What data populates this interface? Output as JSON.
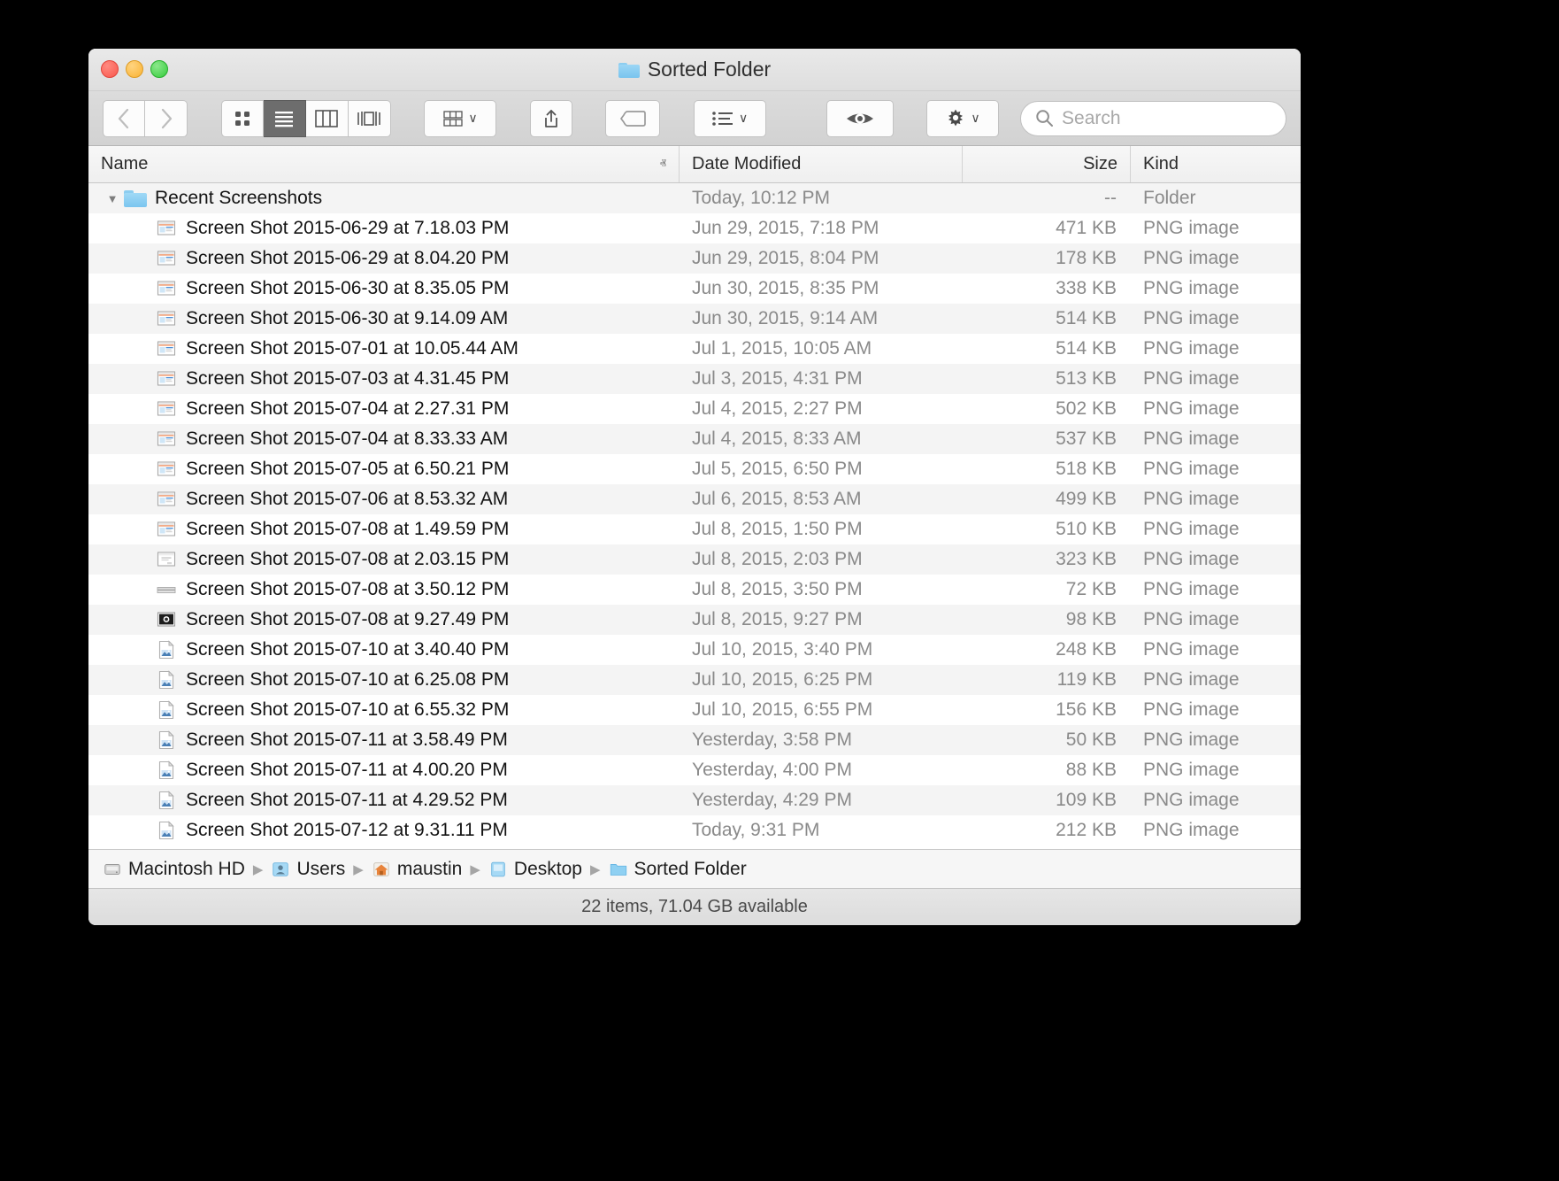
{
  "window": {
    "title": "Sorted Folder",
    "title_icon": "folder-icon",
    "traffic_lights": {
      "close_label": "close",
      "minimize_label": "minimize",
      "zoom_label": "zoom"
    }
  },
  "toolbar": {
    "back_label": "‹",
    "forward_label": "›",
    "view_icon_label": "icon-view",
    "view_list_label": "list-view",
    "view_column_label": "column-view",
    "view_coverflow_label": "coverflow-view",
    "arrange_label": "arrange",
    "share_label": "share",
    "tag_label": "tag",
    "action_list_label": "action-list",
    "quicklook_label": "quick-look",
    "settings_label": "settings",
    "chevron": "∨"
  },
  "search": {
    "placeholder": "Search",
    "value": "",
    "icon": "search-icon"
  },
  "columns": {
    "name": "Name",
    "date_modified": "Date Modified",
    "size": "Size",
    "kind": "Kind",
    "sort_arrow": "ⱏ",
    "sorted_by": "Name",
    "sort_direction": "ascending"
  },
  "rows": [
    {
      "name": "Recent Screenshots",
      "date": "Today, 10:12 PM",
      "size": "--",
      "kind": "Folder",
      "icon": "folder-icon",
      "type": "folder",
      "expanded": true,
      "depth": 0
    },
    {
      "name": "Screen Shot 2015-06-29 at 7.18.03 PM",
      "date": "Jun 29, 2015, 7:18 PM",
      "size": "471 KB",
      "kind": "PNG image",
      "icon": "screenshot-thumb-icon",
      "type": "file",
      "depth": 1
    },
    {
      "name": "Screen Shot 2015-06-29 at 8.04.20 PM",
      "date": "Jun 29, 2015, 8:04 PM",
      "size": "178 KB",
      "kind": "PNG image",
      "icon": "screenshot-thumb-icon",
      "type": "file",
      "depth": 1
    },
    {
      "name": "Screen Shot 2015-06-30 at 8.35.05 PM",
      "date": "Jun 30, 2015, 8:35 PM",
      "size": "338 KB",
      "kind": "PNG image",
      "icon": "screenshot-thumb-icon",
      "type": "file",
      "depth": 1
    },
    {
      "name": "Screen Shot 2015-06-30 at 9.14.09 AM",
      "date": "Jun 30, 2015, 9:14 AM",
      "size": "514 KB",
      "kind": "PNG image",
      "icon": "screenshot-thumb-icon",
      "type": "file",
      "depth": 1
    },
    {
      "name": "Screen Shot 2015-07-01 at 10.05.44 AM",
      "date": "Jul 1, 2015, 10:05 AM",
      "size": "514 KB",
      "kind": "PNG image",
      "icon": "screenshot-thumb-icon",
      "type": "file",
      "depth": 1
    },
    {
      "name": "Screen Shot 2015-07-03 at 4.31.45 PM",
      "date": "Jul 3, 2015, 4:31 PM",
      "size": "513 KB",
      "kind": "PNG image",
      "icon": "screenshot-thumb-icon",
      "type": "file",
      "depth": 1
    },
    {
      "name": "Screen Shot 2015-07-04 at 2.27.31 PM",
      "date": "Jul 4, 2015, 2:27 PM",
      "size": "502 KB",
      "kind": "PNG image",
      "icon": "screenshot-thumb-icon",
      "type": "file",
      "depth": 1
    },
    {
      "name": "Screen Shot 2015-07-04 at 8.33.33 AM",
      "date": "Jul 4, 2015, 8:33 AM",
      "size": "537 KB",
      "kind": "PNG image",
      "icon": "screenshot-thumb-icon",
      "type": "file",
      "depth": 1
    },
    {
      "name": "Screen Shot 2015-07-05 at 6.50.21 PM",
      "date": "Jul 5, 2015, 6:50 PM",
      "size": "518 KB",
      "kind": "PNG image",
      "icon": "screenshot-thumb-icon",
      "type": "file",
      "depth": 1
    },
    {
      "name": "Screen Shot 2015-07-06 at 8.53.32 AM",
      "date": "Jul 6, 2015, 8:53 AM",
      "size": "499 KB",
      "kind": "PNG image",
      "icon": "screenshot-thumb-icon",
      "type": "file",
      "depth": 1
    },
    {
      "name": "Screen Shot 2015-07-08 at 1.49.59 PM",
      "date": "Jul 8, 2015, 1:50 PM",
      "size": "510 KB",
      "kind": "PNG image",
      "icon": "screenshot-thumb-icon",
      "type": "file",
      "depth": 1
    },
    {
      "name": "Screen Shot 2015-07-08 at 2.03.15 PM",
      "date": "Jul 8, 2015, 2:03 PM",
      "size": "323 KB",
      "kind": "PNG image",
      "icon": "screenshot-dialog-icon",
      "type": "file",
      "depth": 1
    },
    {
      "name": "Screen Shot 2015-07-08 at 3.50.12 PM",
      "date": "Jul 8, 2015, 3:50 PM",
      "size": "72 KB",
      "kind": "PNG image",
      "icon": "screenshot-bar-icon",
      "type": "file",
      "depth": 1
    },
    {
      "name": "Screen Shot 2015-07-08 at 9.27.49 PM",
      "date": "Jul 8, 2015, 9:27 PM",
      "size": "98 KB",
      "kind": "PNG image",
      "icon": "screenshot-dark-icon",
      "type": "file",
      "depth": 1
    },
    {
      "name": "Screen Shot 2015-07-10 at 3.40.40 PM",
      "date": "Jul 10, 2015, 3:40 PM",
      "size": "248 KB",
      "kind": "PNG image",
      "icon": "png-document-icon",
      "type": "file",
      "depth": 1
    },
    {
      "name": "Screen Shot 2015-07-10 at 6.25.08 PM",
      "date": "Jul 10, 2015, 6:25 PM",
      "size": "119 KB",
      "kind": "PNG image",
      "icon": "png-document-icon",
      "type": "file",
      "depth": 1
    },
    {
      "name": "Screen Shot 2015-07-10 at 6.55.32 PM",
      "date": "Jul 10, 2015, 6:55 PM",
      "size": "156 KB",
      "kind": "PNG image",
      "icon": "png-document-icon",
      "type": "file",
      "depth": 1
    },
    {
      "name": "Screen Shot 2015-07-11 at 3.58.49 PM",
      "date": "Yesterday, 3:58 PM",
      "size": "50 KB",
      "kind": "PNG image",
      "icon": "png-document-icon",
      "type": "file",
      "depth": 1
    },
    {
      "name": "Screen Shot 2015-07-11 at 4.00.20 PM",
      "date": "Yesterday, 4:00 PM",
      "size": "88 KB",
      "kind": "PNG image",
      "icon": "png-document-icon",
      "type": "file",
      "depth": 1
    },
    {
      "name": "Screen Shot 2015-07-11 at 4.29.52 PM",
      "date": "Yesterday, 4:29 PM",
      "size": "109 KB",
      "kind": "PNG image",
      "icon": "png-document-icon",
      "type": "file",
      "depth": 1
    },
    {
      "name": "Screen Shot 2015-07-12 at 9.31.11 PM",
      "date": "Today, 9:31 PM",
      "size": "212 KB",
      "kind": "PNG image",
      "icon": "png-document-icon",
      "type": "file",
      "depth": 1
    }
  ],
  "path_bar": {
    "segments": [
      {
        "label": "Macintosh HD",
        "icon": "hard-drive-icon"
      },
      {
        "label": "Users",
        "icon": "users-folder-icon"
      },
      {
        "label": "maustin",
        "icon": "home-folder-icon"
      },
      {
        "label": "Desktop",
        "icon": "desktop-folder-icon"
      },
      {
        "label": "Sorted Folder",
        "icon": "folder-icon"
      }
    ],
    "separator": "▶"
  },
  "status_bar": {
    "text": "22 items, 71.04 GB available"
  },
  "colors": {
    "folder_blue": "#7ac5ef",
    "accent_selected": "#6d6d6d",
    "window_bg": "#ffffff",
    "alt_row": "#f4f4f4"
  }
}
